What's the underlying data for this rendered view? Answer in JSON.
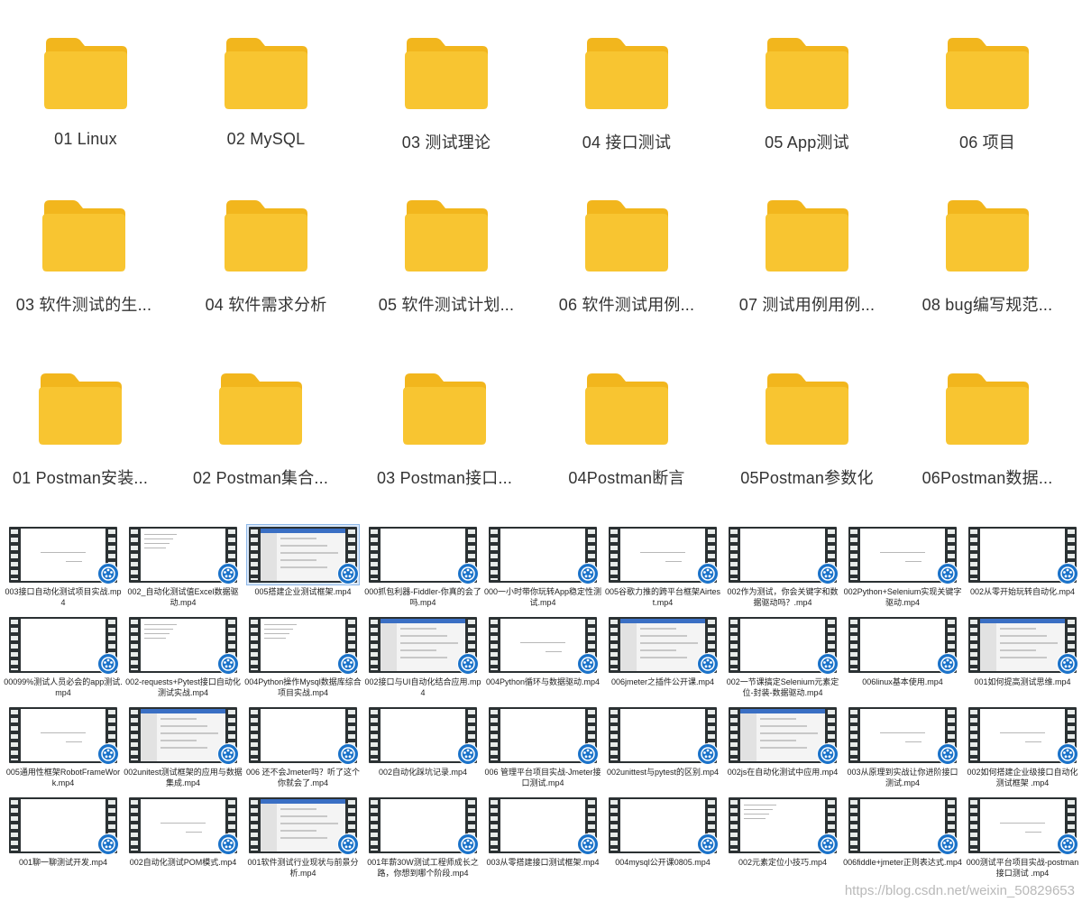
{
  "folders": [
    [
      "01 Linux",
      "02 MySQL",
      "03 测试理论",
      "04 接口测试",
      "05 App测试",
      "06 项目"
    ],
    [
      "03 软件测试的生...",
      "04 软件需求分析",
      "05 软件测试计划...",
      "06 软件测试用例...",
      "07 测试用例用例...",
      "08 bug编写规范..."
    ],
    [
      "01 Postman安装...",
      "02 Postman集合...",
      "03 Postman接口...",
      "04Postman断言",
      "05Postman参数化",
      "06Postman数据..."
    ]
  ],
  "videos": [
    [
      "003接口自动化测试项目实战.mp4",
      "002_自动化测试值Excel数据驱动.mp4",
      "005搭建企业测试框架.mp4",
      "000抓包利器-Fiddler-你真的会了吗.mp4",
      "000一小时带你玩转App稳定性测试.mp4",
      "005谷歌力推的跨平台框架Airtest.mp4",
      "002作为测试，你会关键字和数据驱动吗？.mp4",
      "002Python+Selenium实现关键字驱动.mp4",
      "002从零开始玩转自动化.mp4"
    ],
    [
      "00099%测试人员必会的app测试.mp4",
      "002-requests+Pytest接口自动化测试实战.mp4",
      "004Python操作Mysql数据库综合项目实战.mp4",
      "002接口与UI自动化结合应用.mp4",
      "004Python循环与数据驱动.mp4",
      "006jmeter之插件公开课.mp4",
      "002一节课搞定Selenium元素定位-封装-数据驱动.mp4",
      "006linux基本使用.mp4",
      "001如何提高测试思维.mp4"
    ],
    [
      "005通用性框架RobotFrameWork.mp4",
      "002unitest测试框架的应用与数据集成.mp4",
      "006 还不会Jmeter吗？听了这个你就会了.mp4",
      "002自动化踩坑记录.mp4",
      "006 管理平台项目实战-Jmeter接口测试.mp4",
      "002unittest与pytest的区别.mp4",
      "002js在自动化测试中应用.mp4",
      "003从原理到实战让你进阶接口测试.mp4",
      "002如何搭建企业级接口自动化测试框架 .mp4"
    ],
    [
      "001聊一聊测试开发.mp4",
      "002自动化测试POM模式.mp4",
      "001软件测试行业现状与前景分析.mp4",
      "001年薪30W测试工程师成长之路，你想到哪个阶段.mp4",
      "003从零搭建接口测试框架.mp4",
      "004mysql公开课0805.mp4",
      "002元素定位小技巧.mp4",
      "006fiddle+jmeter正则表达式.mp4",
      "000测试平台项目实战-postman接口测试 .mp4"
    ]
  ],
  "selected_video": "005搭建企业测试框架.mp4",
  "watermark": "https://blog.csdn.net/weixin_50829653",
  "colors": {
    "folder": "#f8c531",
    "folder_tab": "#f2b61d",
    "badge": "#1a72c9",
    "selected_bg": "#d9e8fb"
  }
}
